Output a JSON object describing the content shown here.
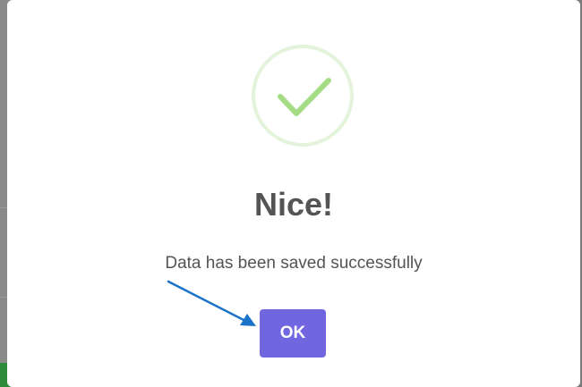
{
  "dialog": {
    "title": "Nice!",
    "message": "Data has been saved successfully",
    "ok_label": "OK",
    "icon": "checkmark-icon"
  },
  "colors": {
    "accent": "#7066e0",
    "success": "#a5dc86",
    "success_ring": "#e4f3dc",
    "annotation_arrow": "#1a73c8",
    "text": "#545454"
  }
}
